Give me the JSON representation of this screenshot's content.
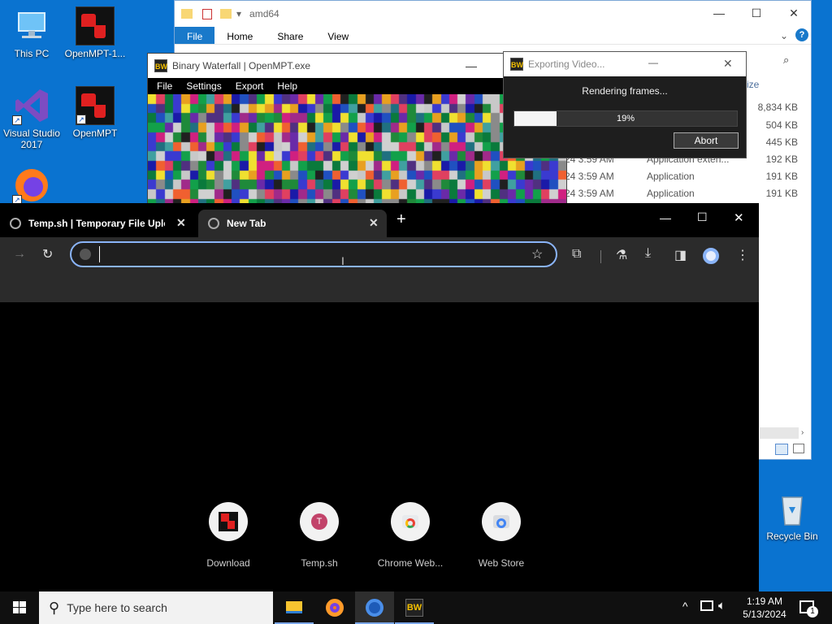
{
  "desktop": {
    "icons": [
      {
        "label": "This PC"
      },
      {
        "label": "OpenMPT-1..."
      },
      {
        "label": "Visual Studio 2017"
      },
      {
        "label": "OpenMPT"
      },
      {
        "label": "Recycle Bin"
      }
    ]
  },
  "explorer": {
    "title": "amd64",
    "ribbon": [
      "File",
      "Home",
      "Share",
      "View"
    ],
    "size_header": "ize",
    "rows": [
      {
        "date": "",
        "type": "",
        "size": "8,834 KB"
      },
      {
        "date": "",
        "type": "",
        "size": "504 KB"
      },
      {
        "date": "",
        "type": "",
        "size": "445 KB"
      },
      {
        "date": "24 3:59 AM",
        "type": "Application exten...",
        "size": "192 KB"
      },
      {
        "date": "24 3:59 AM",
        "type": "Application",
        "size": "191 KB"
      },
      {
        "date": "24 3:59 AM",
        "type": "Application",
        "size": "191 KB"
      }
    ]
  },
  "waterfall": {
    "title": "Binary Waterfall | OpenMPT.exe",
    "menu": [
      "File",
      "Settings",
      "Export",
      "Help"
    ],
    "icon_text": "BW"
  },
  "export_dialog": {
    "title": "Exporting Video...",
    "message": "Rendering frames...",
    "progress": 0.19,
    "progress_label": "19%",
    "abort_label": "Abort"
  },
  "browser": {
    "tabs": [
      {
        "label": "Temp.sh | Temporary File Uplo"
      },
      {
        "label": "New Tab"
      }
    ],
    "new_tab_symbol": "+",
    "address_value": "",
    "shortcuts": [
      {
        "label": "Download"
      },
      {
        "label": "Temp.sh",
        "initial": "T"
      },
      {
        "label": "Chrome Web..."
      },
      {
        "label": "Web Store"
      }
    ]
  },
  "taskbar": {
    "search_placeholder": "Type here to search",
    "time": "1:19 AM",
    "date": "5/13/2024",
    "notification_count": "1"
  },
  "colors": {
    "desktop": "#0a73d0",
    "accent": "#1979ca",
    "focus_ring": "#8ab4f8"
  }
}
